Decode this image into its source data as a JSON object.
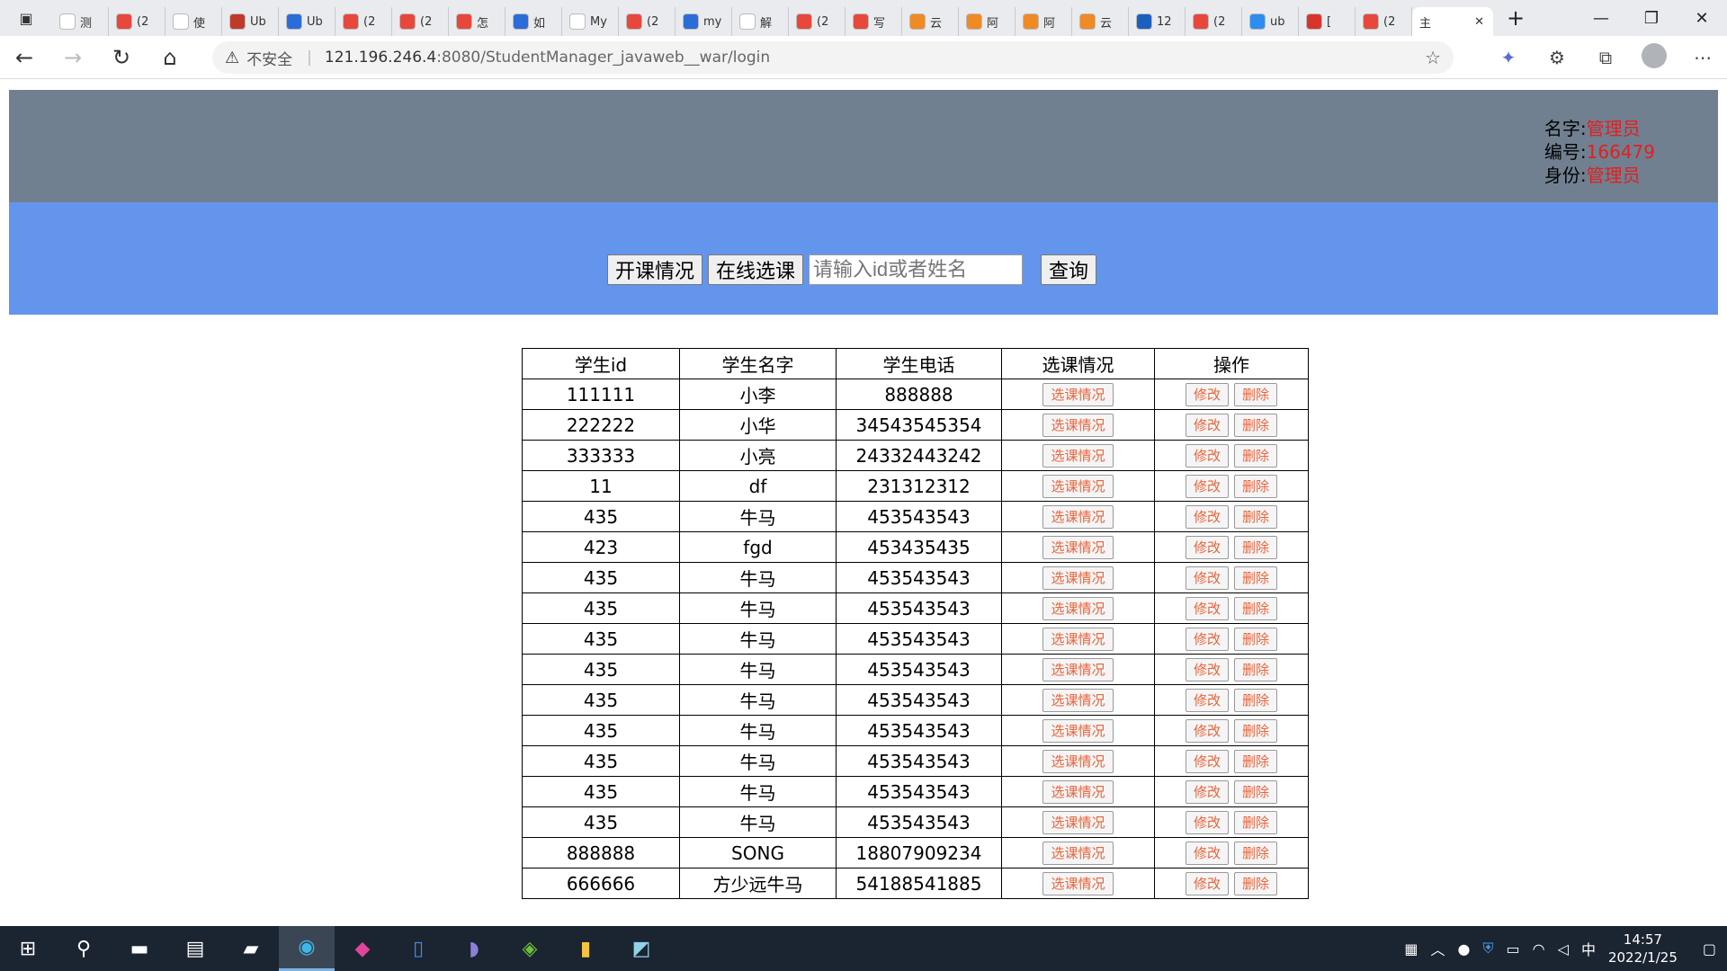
{
  "browser": {
    "tabs": [
      {
        "label": "测",
        "color": "#ffffff",
        "icon": "doc-icon"
      },
      {
        "label": "(2",
        "color": "#e8473c",
        "icon": "csdn-icon"
      },
      {
        "label": "使",
        "color": "#ffffff",
        "icon": "zhihu-icon"
      },
      {
        "label": "Ub",
        "color": "#c0392b",
        "icon": "b-icon"
      },
      {
        "label": "Ub",
        "color": "#2b6cd8",
        "icon": "paw-icon"
      },
      {
        "label": "(2",
        "color": "#e8473c",
        "icon": "csdn-icon"
      },
      {
        "label": "(2",
        "color": "#e8473c",
        "icon": "csdn-icon"
      },
      {
        "label": "怎",
        "color": "#e8473c",
        "icon": "php-icon"
      },
      {
        "label": "如",
        "color": "#2b6cd8",
        "icon": "paw-icon"
      },
      {
        "label": "My",
        "color": "#ffffff",
        "icon": "zhihu-icon"
      },
      {
        "label": "(2",
        "color": "#e8473c",
        "icon": "csdn-icon"
      },
      {
        "label": "my",
        "color": "#2b6cd8",
        "icon": "paw-icon"
      },
      {
        "label": "解",
        "color": "#ffffff",
        "icon": "zhihu-icon"
      },
      {
        "label": "(2",
        "color": "#e8473c",
        "icon": "csdn-icon"
      },
      {
        "label": "写",
        "color": "#e8473c",
        "icon": "csdn-icon"
      },
      {
        "label": "云",
        "color": "#f08a24",
        "icon": "aliyun-icon"
      },
      {
        "label": "阿",
        "color": "#f08a24",
        "icon": "aliyun-icon"
      },
      {
        "label": "阿",
        "color": "#f08a24",
        "icon": "aliyun-icon"
      },
      {
        "label": "云",
        "color": "#f08a24",
        "icon": "aliyun-icon"
      },
      {
        "label": "12",
        "color": "#1d5fbf",
        "icon": "tool-icon"
      },
      {
        "label": "(2",
        "color": "#e8473c",
        "icon": "csdn-icon"
      },
      {
        "label": "ub",
        "color": "#2d8cf0",
        "icon": "s-icon"
      },
      {
        "label": "[",
        "color": "#d9342b",
        "icon": "g-icon"
      },
      {
        "label": "(2",
        "color": "#e8473c",
        "icon": "csdn-icon"
      }
    ],
    "active_tab": {
      "label": "主"
    },
    "security_label": "不安全",
    "url_host": "121.196.246.4",
    "url_path": ":8080/StudentManager_javaweb__war/login"
  },
  "header": {
    "name_label": "名字:",
    "name_value": "管理员",
    "id_label": "编号:",
    "id_value": "166479",
    "role_label": "身份:",
    "role_value": "管理员"
  },
  "controls": {
    "course_button": "开课情况",
    "select_button": "在线选课",
    "search_placeholder": "请输入id或者姓名",
    "query_button": "查询"
  },
  "table": {
    "headers": [
      "学生id",
      "学生名字",
      "学生电话",
      "选课情况",
      "操作"
    ],
    "action_labels": {
      "course": "选课情况",
      "edit": "修改",
      "delete": "删除"
    },
    "rows": [
      [
        "111111",
        "小李",
        "888888"
      ],
      [
        "222222",
        "小华",
        "34543545354"
      ],
      [
        "333333",
        "小亮",
        "24332443242"
      ],
      [
        "11",
        "df",
        "231312312"
      ],
      [
        "435",
        "牛马",
        "453543543"
      ],
      [
        "423",
        "fgd",
        "453435435"
      ],
      [
        "435",
        "牛马",
        "453543543"
      ],
      [
        "435",
        "牛马",
        "453543543"
      ],
      [
        "435",
        "牛马",
        "453543543"
      ],
      [
        "435",
        "牛马",
        "453543543"
      ],
      [
        "435",
        "牛马",
        "453543543"
      ],
      [
        "435",
        "牛马",
        "453543543"
      ],
      [
        "435",
        "牛马",
        "453543543"
      ],
      [
        "435",
        "牛马",
        "453543543"
      ],
      [
        "435",
        "牛马",
        "453543543"
      ],
      [
        "888888",
        "SONG",
        "18807909234"
      ],
      [
        "666666",
        "方少远牛马",
        "54188541885"
      ]
    ]
  },
  "taskbar": {
    "ime": "中",
    "time": "14:57",
    "date": "2022/1/25"
  },
  "colors": {
    "top_band": "#708090",
    "blue_band": "#6495ed",
    "accent_red": "#e02020",
    "action_text": "#e8643c"
  }
}
